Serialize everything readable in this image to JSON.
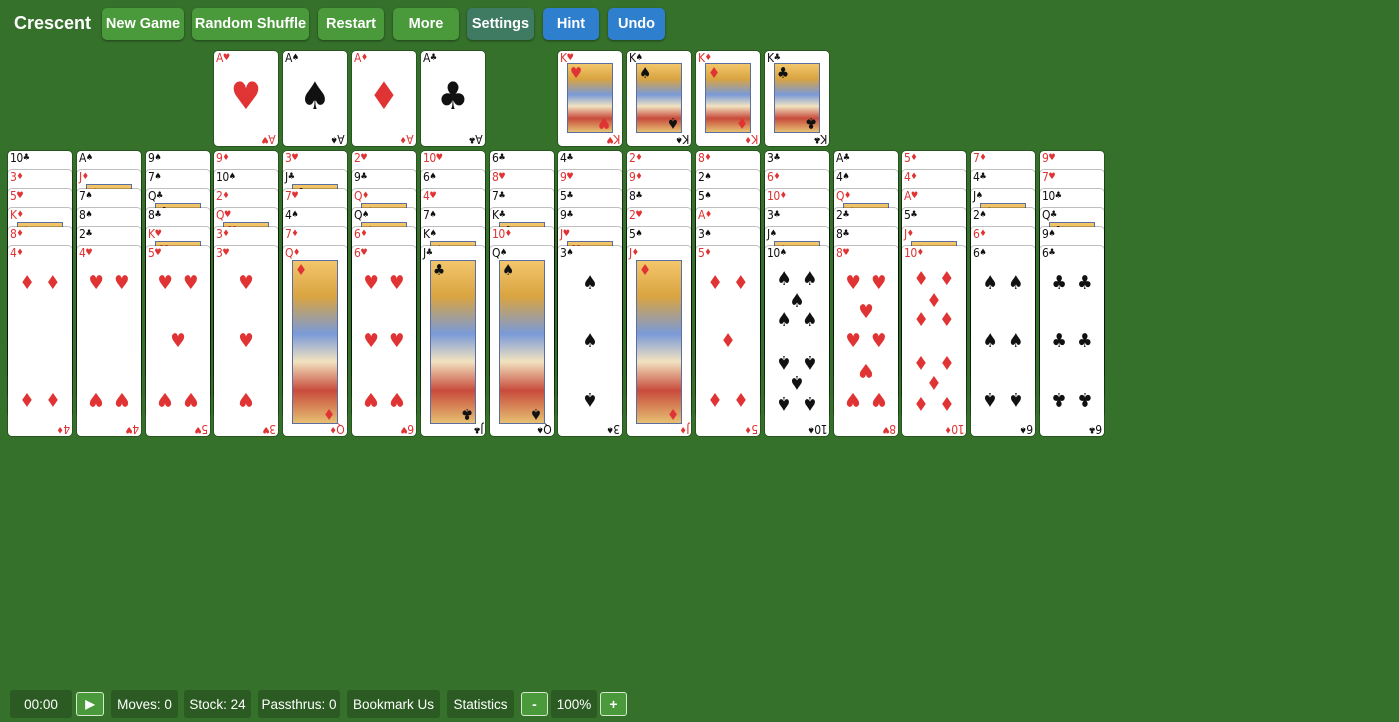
{
  "app": {
    "title": "Crescent"
  },
  "toolbar": [
    {
      "name": "new-game-button",
      "label": "New Game",
      "style": "green"
    },
    {
      "name": "random-shuffle-button",
      "label": "Random Shuffle",
      "style": "green"
    },
    {
      "name": "restart-button",
      "label": "Restart",
      "style": "green"
    },
    {
      "name": "more-button",
      "label": "More",
      "style": "green"
    },
    {
      "name": "settings-button",
      "label": "Settings",
      "style": "teal"
    },
    {
      "name": "hint-button",
      "label": "Hint",
      "style": "blue"
    },
    {
      "name": "undo-button",
      "label": "Undo",
      "style": "blue"
    }
  ],
  "foundations_ace": [
    {
      "rank": "A",
      "suit": "♥",
      "color": "red"
    },
    {
      "rank": "A",
      "suit": "♠",
      "color": "black"
    },
    {
      "rank": "A",
      "suit": "♦",
      "color": "red"
    },
    {
      "rank": "A",
      "suit": "♣",
      "color": "black"
    }
  ],
  "foundations_king": [
    {
      "rank": "K",
      "suit": "♥",
      "color": "red"
    },
    {
      "rank": "K",
      "suit": "♠",
      "color": "black"
    },
    {
      "rank": "K",
      "suit": "♦",
      "color": "red"
    },
    {
      "rank": "K",
      "suit": "♣",
      "color": "black"
    }
  ],
  "tableau": [
    [
      {
        "rank": "10",
        "suit": "♣"
      },
      {
        "rank": "3",
        "suit": "♦"
      },
      {
        "rank": "5",
        "suit": "♥"
      },
      {
        "rank": "K",
        "suit": "♦"
      },
      {
        "rank": "8",
        "suit": "♦"
      },
      {
        "rank": "4",
        "suit": "♦"
      }
    ],
    [
      {
        "rank": "A",
        "suit": "♠"
      },
      {
        "rank": "J",
        "suit": "♦"
      },
      {
        "rank": "7",
        "suit": "♠"
      },
      {
        "rank": "8",
        "suit": "♠"
      },
      {
        "rank": "2",
        "suit": "♣"
      },
      {
        "rank": "4",
        "suit": "♥"
      }
    ],
    [
      {
        "rank": "9",
        "suit": "♠"
      },
      {
        "rank": "7",
        "suit": "♠"
      },
      {
        "rank": "Q",
        "suit": "♣"
      },
      {
        "rank": "8",
        "suit": "♣"
      },
      {
        "rank": "K",
        "suit": "♥"
      },
      {
        "rank": "5",
        "suit": "♥"
      }
    ],
    [
      {
        "rank": "9",
        "suit": "♦"
      },
      {
        "rank": "10",
        "suit": "♠"
      },
      {
        "rank": "2",
        "suit": "♦"
      },
      {
        "rank": "Q",
        "suit": "♥"
      },
      {
        "rank": "3",
        "suit": "♦"
      },
      {
        "rank": "3",
        "suit": "♥"
      }
    ],
    [
      {
        "rank": "3",
        "suit": "♥"
      },
      {
        "rank": "J",
        "suit": "♣"
      },
      {
        "rank": "7",
        "suit": "♥"
      },
      {
        "rank": "4",
        "suit": "♠"
      },
      {
        "rank": "7",
        "suit": "♦"
      },
      {
        "rank": "Q",
        "suit": "♦"
      }
    ],
    [
      {
        "rank": "2",
        "suit": "♥"
      },
      {
        "rank": "9",
        "suit": "♣"
      },
      {
        "rank": "Q",
        "suit": "♦"
      },
      {
        "rank": "Q",
        "suit": "♠"
      },
      {
        "rank": "6",
        "suit": "♦"
      },
      {
        "rank": "6",
        "suit": "♥"
      }
    ],
    [
      {
        "rank": "10",
        "suit": "♥"
      },
      {
        "rank": "6",
        "suit": "♠"
      },
      {
        "rank": "4",
        "suit": "♥"
      },
      {
        "rank": "7",
        "suit": "♠"
      },
      {
        "rank": "K",
        "suit": "♠"
      },
      {
        "rank": "J",
        "suit": "♣"
      }
    ],
    [
      {
        "rank": "6",
        "suit": "♣"
      },
      {
        "rank": "8",
        "suit": "♥"
      },
      {
        "rank": "7",
        "suit": "♣"
      },
      {
        "rank": "K",
        "suit": "♣"
      },
      {
        "rank": "10",
        "suit": "♦"
      },
      {
        "rank": "Q",
        "suit": "♠"
      }
    ],
    [
      {
        "rank": "4",
        "suit": "♣"
      },
      {
        "rank": "9",
        "suit": "♥"
      },
      {
        "rank": "5",
        "suit": "♣"
      },
      {
        "rank": "9",
        "suit": "♣"
      },
      {
        "rank": "J",
        "suit": "♥"
      },
      {
        "rank": "3",
        "suit": "♠"
      }
    ],
    [
      {
        "rank": "2",
        "suit": "♦"
      },
      {
        "rank": "9",
        "suit": "♦"
      },
      {
        "rank": "8",
        "suit": "♣"
      },
      {
        "rank": "2",
        "suit": "♥"
      },
      {
        "rank": "5",
        "suit": "♠"
      },
      {
        "rank": "J",
        "suit": "♦"
      }
    ],
    [
      {
        "rank": "8",
        "suit": "♦"
      },
      {
        "rank": "2",
        "suit": "♠"
      },
      {
        "rank": "5",
        "suit": "♠"
      },
      {
        "rank": "A",
        "suit": "♦"
      },
      {
        "rank": "3",
        "suit": "♠"
      },
      {
        "rank": "5",
        "suit": "♦"
      }
    ],
    [
      {
        "rank": "3",
        "suit": "♣"
      },
      {
        "rank": "6",
        "suit": "♦"
      },
      {
        "rank": "10",
        "suit": "♦"
      },
      {
        "rank": "3",
        "suit": "♣"
      },
      {
        "rank": "J",
        "suit": "♠"
      },
      {
        "rank": "10",
        "suit": "♠"
      }
    ],
    [
      {
        "rank": "A",
        "suit": "♣"
      },
      {
        "rank": "4",
        "suit": "♠"
      },
      {
        "rank": "Q",
        "suit": "♦"
      },
      {
        "rank": "2",
        "suit": "♣"
      },
      {
        "rank": "8",
        "suit": "♣"
      },
      {
        "rank": "8",
        "suit": "♥"
      }
    ],
    [
      {
        "rank": "5",
        "suit": "♦"
      },
      {
        "rank": "4",
        "suit": "♦"
      },
      {
        "rank": "A",
        "suit": "♥"
      },
      {
        "rank": "5",
        "suit": "♣"
      },
      {
        "rank": "J",
        "suit": "♦"
      },
      {
        "rank": "10",
        "suit": "♦"
      }
    ],
    [
      {
        "rank": "7",
        "suit": "♦"
      },
      {
        "rank": "4",
        "suit": "♣"
      },
      {
        "rank": "J",
        "suit": "♠"
      },
      {
        "rank": "2",
        "suit": "♠"
      },
      {
        "rank": "6",
        "suit": "♦"
      },
      {
        "rank": "6",
        "suit": "♠"
      }
    ],
    [
      {
        "rank": "9",
        "suit": "♥"
      },
      {
        "rank": "7",
        "suit": "♥"
      },
      {
        "rank": "10",
        "suit": "♣"
      },
      {
        "rank": "Q",
        "suit": "♣"
      },
      {
        "rank": "9",
        "suit": "♠"
      },
      {
        "rank": "6",
        "suit": "♣"
      }
    ]
  ],
  "status": {
    "timer": "00:00",
    "play_icon": "▶",
    "moves": "Moves: 0",
    "stock": "Stock: 24",
    "passthrus": "Passthrus: 0",
    "bookmark": "Bookmark Us",
    "statistics": "Statistics",
    "zoom_out": "-",
    "zoom": "100%",
    "zoom_in": "+"
  }
}
